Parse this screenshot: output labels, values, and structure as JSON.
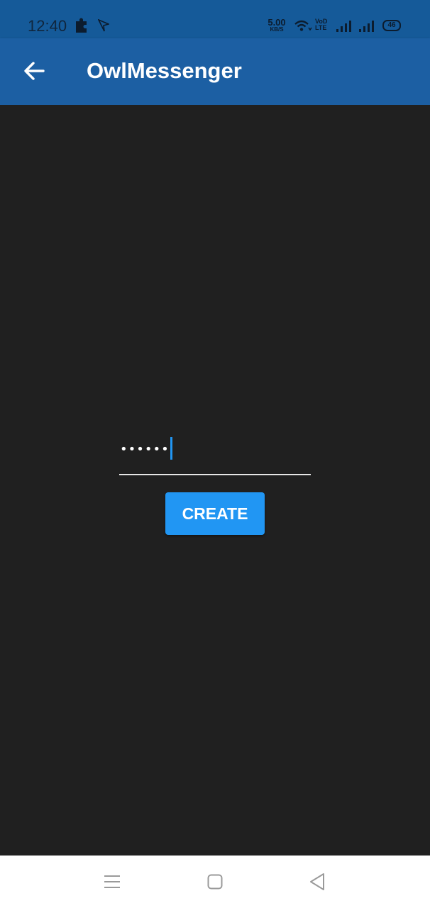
{
  "status_bar": {
    "time": "12:40",
    "net_speed_value": "5.00",
    "net_speed_unit": "KB/S",
    "volte_top": "VoD",
    "volte_bottom": "LTE",
    "battery": "46",
    "icons": [
      "puzzle-icon",
      "navigation-icon",
      "wifi-icon",
      "signal-icon",
      "signal-icon",
      "battery-icon"
    ]
  },
  "app_bar": {
    "title": "OwlMessenger",
    "back_icon": "arrow-left-icon",
    "color": "#1c5fa3"
  },
  "form": {
    "password_value": "••••••",
    "button_label": "CREATE",
    "button_color": "#2196f3"
  },
  "nav_bar": {
    "icons": [
      "menu-icon",
      "home-icon",
      "back-icon"
    ]
  },
  "colors": {
    "background": "#202020",
    "status_bar": "#155a99"
  }
}
